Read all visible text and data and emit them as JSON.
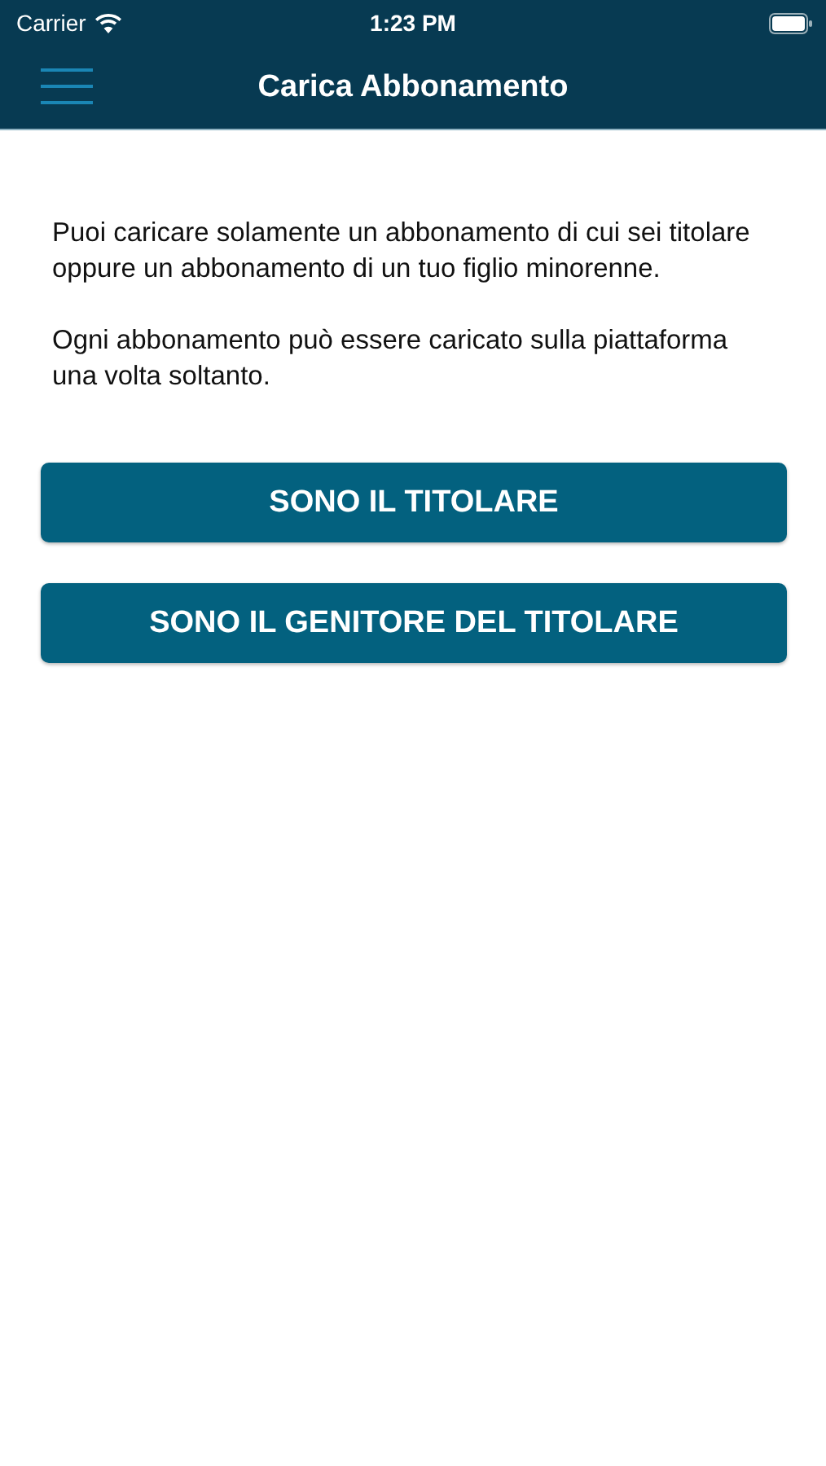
{
  "status_bar": {
    "carrier": "Carrier",
    "time": "1:23 PM"
  },
  "nav_bar": {
    "title": "Carica Abbonamento"
  },
  "paragraphs": [
    "Puoi caricare solamente un abbonamento di cui sei titolare oppure un abbonamento di un tuo figlio minorenne.",
    "Ogni abbonamento può essere caricato sulla piattaforma una volta soltanto."
  ],
  "buttons": [
    "SONO IL TITOLARE",
    "SONO IL GENITORE DEL TITOLARE"
  ]
}
